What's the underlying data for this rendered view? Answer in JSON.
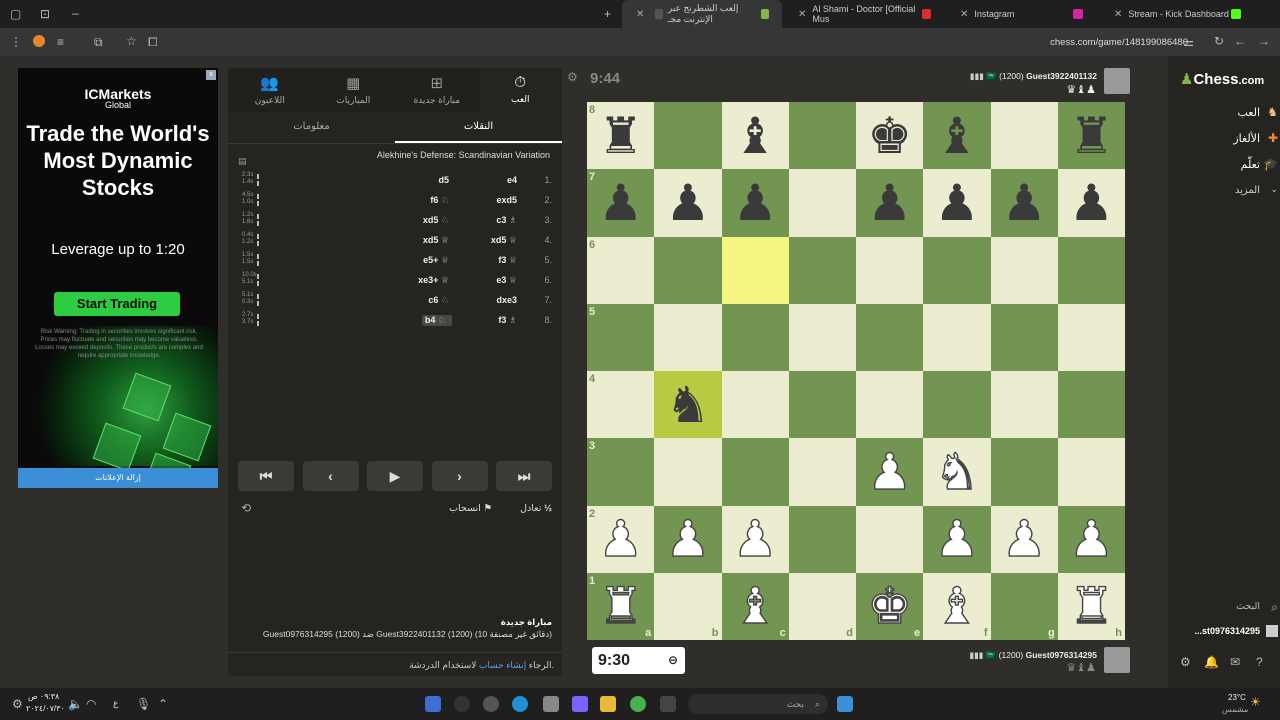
{
  "browser": {
    "tabs": [
      {
        "title": "Stream - Kick Dashboard"
      },
      {
        "title": "Instagram"
      },
      {
        "title": "Al Shami - Doctor [Official Mus"
      },
      {
        "title": "إلعب الشطرنج عبر الإنترنت مجـ"
      }
    ],
    "url": "chess.com/game/148199086480"
  },
  "ad": {
    "brand": "ICMarkets",
    "brand_sub": "Global",
    "headline": "Trade the World's Most Dynamic Stocks",
    "leverage": "Leverage up to 1:20",
    "cta": "Start Trading",
    "risk": "Risk Warning: Trading in securities involves significant risk. Prices may fluctuate and securities may become valueless. Losses may exceed deposits. These products are complex and require appropriate knowledge.",
    "remove": "إزالة الإعلانات"
  },
  "panel": {
    "tabs": [
      {
        "label": "العب",
        "icon": "stopwatch-icon"
      },
      {
        "label": "مباراة جديدة",
        "icon": "plus-icon"
      },
      {
        "label": "المباريات",
        "icon": "board-icon"
      },
      {
        "label": "اللاعبون",
        "icon": "players-icon"
      }
    ],
    "subtabs": {
      "moves": "النقلات",
      "info": "معلومات"
    },
    "opening": "Alekhine's Defense: Scandinavian Variation",
    "moves": [
      {
        "n": "1.",
        "w": "e4",
        "b": "d5",
        "wt": "2.3s",
        "bt": "1.4s",
        "wp": "",
        "bp": ""
      },
      {
        "n": "2.",
        "w": "exd5",
        "b": "f6",
        "wt": "4.5s",
        "bt": "1.0s",
        "wp": "",
        "bp": "♘"
      },
      {
        "n": "3.",
        "w": "c3",
        "b": "xd5",
        "wt": "1.2s",
        "bt": "1.6s",
        "wp": "♗",
        "bp": "♘"
      },
      {
        "n": "4.",
        "w": "xd5",
        "b": "xd5",
        "wt": "0.4s",
        "bt": "1.2s",
        "wp": "♕",
        "bp": "♕"
      },
      {
        "n": "5.",
        "w": "f3",
        "b": "e5+",
        "wt": "1.5s",
        "bt": "1.5s",
        "wp": "♕",
        "bp": "♕"
      },
      {
        "n": "6.",
        "w": "e3",
        "b": "xe3+",
        "wt": "10.0s",
        "bt": "5.1s",
        "wp": "♕",
        "bp": "♕"
      },
      {
        "n": "7.",
        "w": "dxe3",
        "b": "c6",
        "wt": "5.1s",
        "bt": "0.3s",
        "wp": "",
        "bp": "♘"
      },
      {
        "n": "8.",
        "w": "f3",
        "b": "b4",
        "wt": "2.7s",
        "bt": "3.7s",
        "wp": "♗",
        "bp": "♘"
      }
    ],
    "controls": [
      "⏮",
      "‹",
      "▶",
      "›",
      "⏭"
    ],
    "draw": "تعادل",
    "draw_icon": "½",
    "resign": "انسحاب",
    "game_title": "مباراة جديدة",
    "game_desc": "Guest0976314295 (1200) ضد Guest3922401132 (1200) (10 دقائق غير مصنفة)",
    "chat_prefix": "الرجاء",
    "chat_link": "إنشاء حساب",
    "chat_suffix": "لاستخدام الدردشة."
  },
  "game": {
    "top_player": "Guest3922401132",
    "top_rating": "(1200)",
    "top_clock": "9:44",
    "top_captured": "♛♝♟",
    "bottom_player": "Guest0976314295",
    "bottom_rating": "(1200)",
    "bottom_clock": "9:30",
    "bottom_captured": "♛♝♟",
    "highlight_squares": [
      "c6",
      "b4"
    ],
    "files": [
      "a",
      "b",
      "c",
      "d",
      "e",
      "f",
      "g",
      "h"
    ],
    "ranks": [
      "8",
      "7",
      "6",
      "5",
      "4",
      "3",
      "2",
      "1"
    ],
    "board": [
      [
        "r",
        "",
        "b",
        "",
        "k",
        "b",
        "",
        "r"
      ],
      [
        "p",
        "p",
        "p",
        "",
        "p",
        "p",
        "p",
        "p"
      ],
      [
        "",
        "",
        "",
        "",
        "",
        "",
        "",
        ""
      ],
      [
        "",
        "",
        "",
        "",
        "",
        "",
        "",
        ""
      ],
      [
        "",
        "n",
        "",
        "",
        "",
        "",
        "",
        ""
      ],
      [
        "",
        "",
        "",
        "",
        "P",
        "N",
        "",
        ""
      ],
      [
        "P",
        "P",
        "P",
        "",
        "",
        "P",
        "P",
        "P"
      ],
      [
        "R",
        "",
        "B",
        "",
        "K",
        "B",
        "",
        "R"
      ]
    ]
  },
  "site": {
    "logo": "Chess",
    "logo_suffix": ".com",
    "nav": [
      {
        "label": "العب"
      },
      {
        "label": "الألغاز"
      },
      {
        "label": "تعلّم"
      },
      {
        "label": "المزيد"
      }
    ],
    "search": "البحث",
    "user": "...st0976314295"
  },
  "taskbar": {
    "search": "بحث",
    "weather": "23°C",
    "weather_desc": "مشمس",
    "time": "٠٩:٣٨ ص",
    "date": "٢٠٢٤/٠٧/٣٠",
    "lang": "ع"
  }
}
